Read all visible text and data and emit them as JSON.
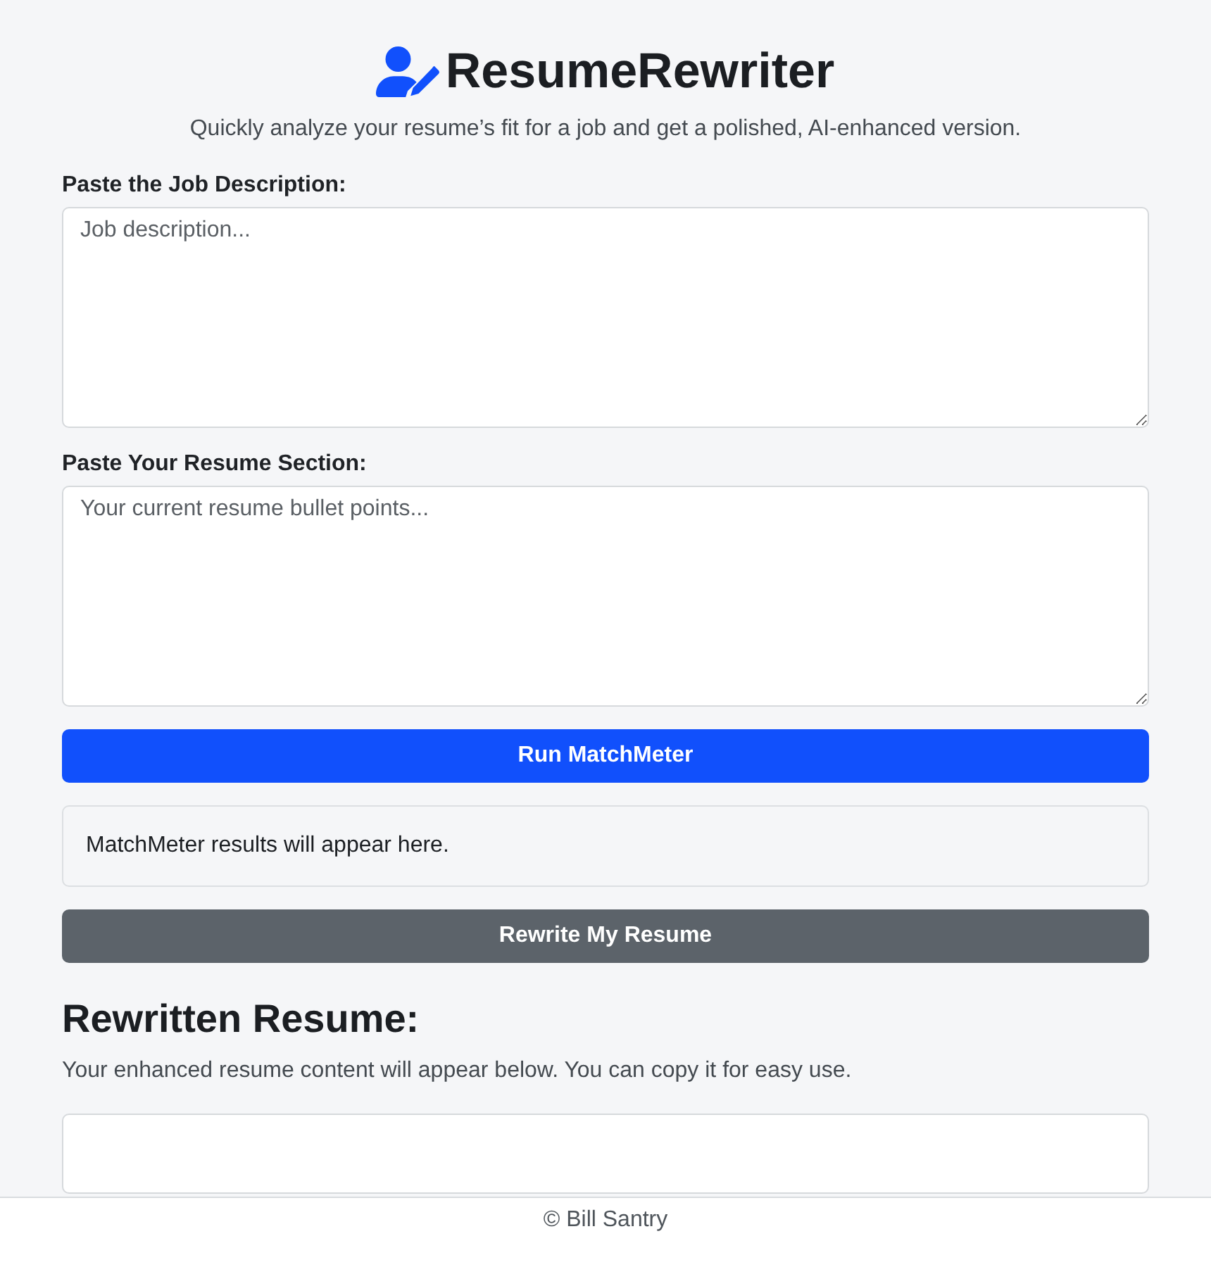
{
  "header": {
    "title": "ResumeRewriter",
    "subtitle": "Quickly analyze your resume’s fit for a job and get a polished, AI-enhanced version."
  },
  "inputs": [
    {
      "label": "Paste the Job Description:",
      "placeholder": "Job description..."
    },
    {
      "label": "Paste Your Resume Section:",
      "placeholder": "Your current resume bullet points..."
    }
  ],
  "match_button": {
    "label": "Run MatchMeter"
  },
  "match_results": {
    "text": "MatchMeter results will appear here."
  },
  "rewrite_button": {
    "label": "Rewrite My Resume"
  },
  "rewritten_section": {
    "heading": "Rewritten Resume:",
    "description": "Your enhanced resume content will appear below. You can copy it for easy use."
  },
  "footer": {
    "text": "© Bill Santry"
  }
}
